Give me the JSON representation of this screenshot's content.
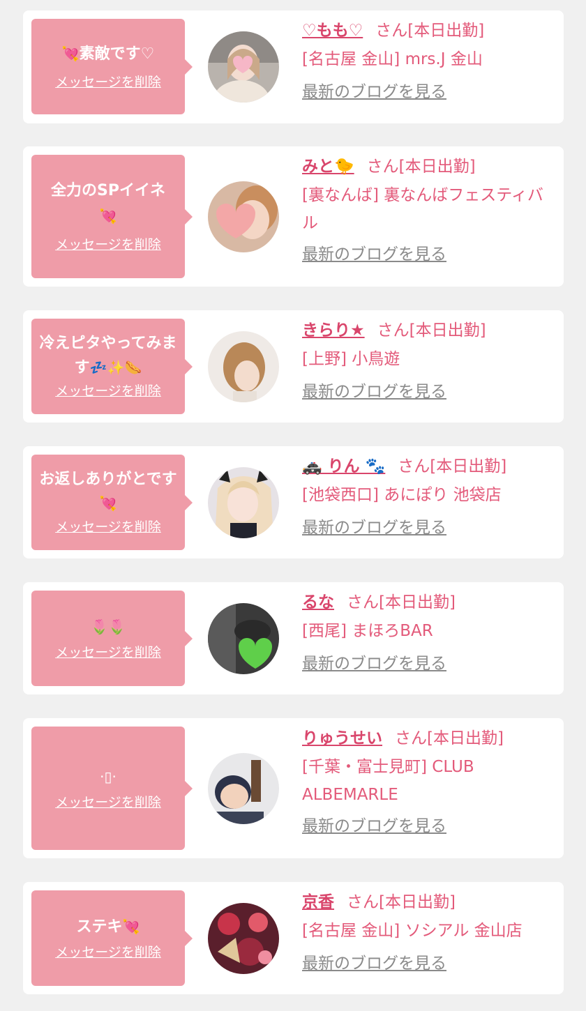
{
  "colors": {
    "background": "#f0f0f0",
    "card": "#ffffff",
    "bubble": "#ef9ca8",
    "name": "#d9456b",
    "text_pink": "#e35a7a",
    "blog_link": "#8a8a8a"
  },
  "delete_label": "メッセージを削除",
  "blog_label": "最新のブログを見る",
  "name_suffix": "さん[本日出勤]",
  "cards": [
    {
      "message_prefix": "💘",
      "message": "素敵です♡",
      "message_suffix": "",
      "name": "♡もも♡",
      "shop": "[名古屋 金山] mrs.J 金山",
      "avatar_icon": "avatar-photo-momo"
    },
    {
      "message_prefix": "",
      "message": "全力のSPイイネ",
      "message_suffix": "💘",
      "name": "みと🐤",
      "shop": "[裏なんば] 裏なんばフェスティバル",
      "avatar_icon": "avatar-photo-mito"
    },
    {
      "message_prefix": "",
      "message": "冷えピタやってみます",
      "message_suffix": "💤✨🌭",
      "name": "きらり★",
      "shop": "[上野] 小鳥遊",
      "avatar_icon": "avatar-photo-kirari"
    },
    {
      "message_prefix": "",
      "message": "お返しありがとです",
      "message_suffix": "💘",
      "name": "🚓 りん 🐾",
      "shop": "[池袋西口] あにぽり 池袋店",
      "avatar_icon": "avatar-photo-rin"
    },
    {
      "message_prefix": "",
      "message": "🌷🌷",
      "message_suffix": "",
      "name": "るな",
      "shop": "[西尾] まほろBAR",
      "avatar_icon": "avatar-photo-runa"
    },
    {
      "message_prefix": "",
      "message": "·▯·",
      "message_suffix": "",
      "name": "りゅうせい",
      "shop": "[千葉・富士見町] CLUB ALBEMARLE",
      "avatar_icon": "avatar-photo-ryusei"
    },
    {
      "message_prefix": "",
      "message": "ステキ",
      "message_suffix": "💘",
      "name": "京香",
      "shop": "[名古屋 金山] ソシアル 金山店",
      "avatar_icon": "avatar-photo-kyoka"
    }
  ]
}
